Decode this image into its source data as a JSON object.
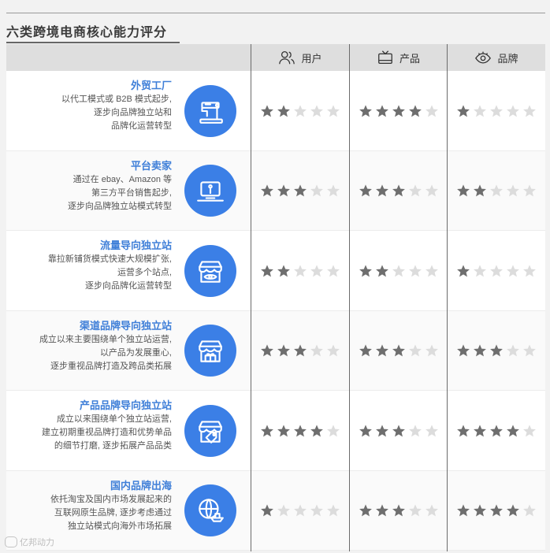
{
  "title": "六类跨境电商核心能力评分",
  "headers": [
    {
      "label": "用户",
      "icon": "users-icon"
    },
    {
      "label": "产品",
      "icon": "tv-icon"
    },
    {
      "label": "品牌",
      "icon": "eye-icon"
    }
  ],
  "rows": [
    {
      "name": "外贸工厂",
      "desc": "以代工模式或 B2B 模式起步,\n逐步向品牌独立站和\n品牌化运营转型",
      "icon": "sewing-machine-icon"
    },
    {
      "name": "平台卖家",
      "desc": "通过在 ebay、Amazon 等\n第三方平台销售起步,\n逐步向品牌独立站模式转型",
      "icon": "laptop-icon"
    },
    {
      "name": "流量导向独立站",
      "desc": "靠拉新铺货模式快速大规模扩张,\n运营多个站点,\n逐步向品牌化运营转型",
      "icon": "store-eye-icon"
    },
    {
      "name": "渠道品牌导向独立站",
      "desc": "成立以来主要围绕单个独立站运营,\n以产品为发展重心,\n逐步重视品牌打造及跨品类拓展",
      "icon": "store-gift-icon"
    },
    {
      "name": "产品品牌导向独立站",
      "desc": "成立以来围绕单个独立站运营,\n建立初期重视品牌打造和优势单品\n的细节打磨, 逐步拓展产品品类",
      "icon": "store-tag-icon"
    },
    {
      "name": "国内品牌出海",
      "desc": "依托淘宝及国内市场发展起来的\n互联网原生品牌, 逐步考虑通过\n独立站模式向海外市场拓展",
      "icon": "globe-ship-icon"
    }
  ],
  "watermark": "亿邦动力",
  "colors": {
    "accent": "#3b7fe6",
    "name_text": "#3f7fd8",
    "star_on": "#6e6e6e",
    "star_off": "#dcdcdc"
  },
  "chart_data": {
    "type": "table",
    "title": "六类跨境电商核心能力评分",
    "columns": [
      "用户",
      "产品",
      "品牌"
    ],
    "max_score": 5,
    "categories": [
      "外贸工厂",
      "平台卖家",
      "流量导向独立站",
      "渠道品牌导向独立站",
      "产品品牌导向独立站",
      "国内品牌出海"
    ],
    "series": [
      {
        "name": "用户",
        "values": [
          2,
          3,
          2,
          3,
          4,
          1
        ]
      },
      {
        "name": "产品",
        "values": [
          4,
          3,
          2,
          3,
          3,
          3
        ]
      },
      {
        "name": "品牌",
        "values": [
          1,
          2,
          1,
          3,
          4,
          4
        ]
      }
    ]
  }
}
